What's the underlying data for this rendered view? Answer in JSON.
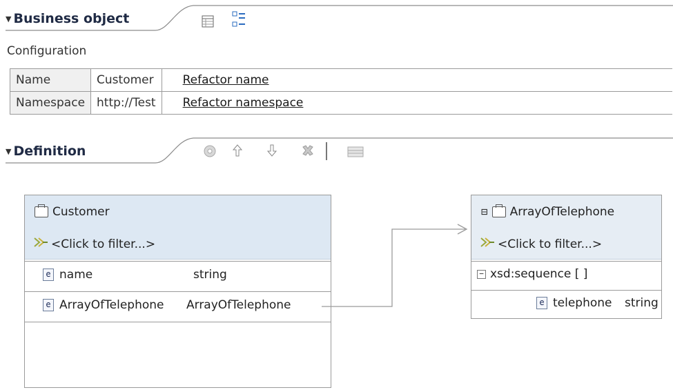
{
  "business_object": {
    "title": "Business object",
    "toolbar_icons": [
      "table-view-icon",
      "tree-view-icon"
    ]
  },
  "configuration": {
    "label": "Configuration",
    "rows": [
      {
        "key": "Name",
        "value": "Customer",
        "link": "Refactor name"
      },
      {
        "key": "Namespace",
        "value": "http://Test",
        "link": "Refactor namespace"
      }
    ]
  },
  "definition": {
    "title": "Definition",
    "toolbar_icons": [
      "add-icon",
      "move-up-icon",
      "move-down-icon",
      "delete-icon",
      "separator",
      "layout-icon"
    ]
  },
  "customer_box": {
    "title": "Customer",
    "filter": "<Click to filter...>",
    "fields": [
      {
        "name": "name",
        "type": "string",
        "icon": "e"
      },
      {
        "name": "ArrayOfTelephone",
        "type": "ArrayOfTelephone",
        "icon": "e"
      }
    ]
  },
  "array_box": {
    "collapse": "⊟",
    "title": "ArrayOfTelephone",
    "filter": "<Click to filter...>",
    "sequence": "xsd:sequence [ ]",
    "fields": [
      {
        "name": "telephone",
        "type": "string",
        "icon": "e"
      }
    ]
  },
  "colors": {
    "header_blue": "#dde8f3",
    "section_title": "#1f2a44",
    "border": "#9a9a9a"
  }
}
